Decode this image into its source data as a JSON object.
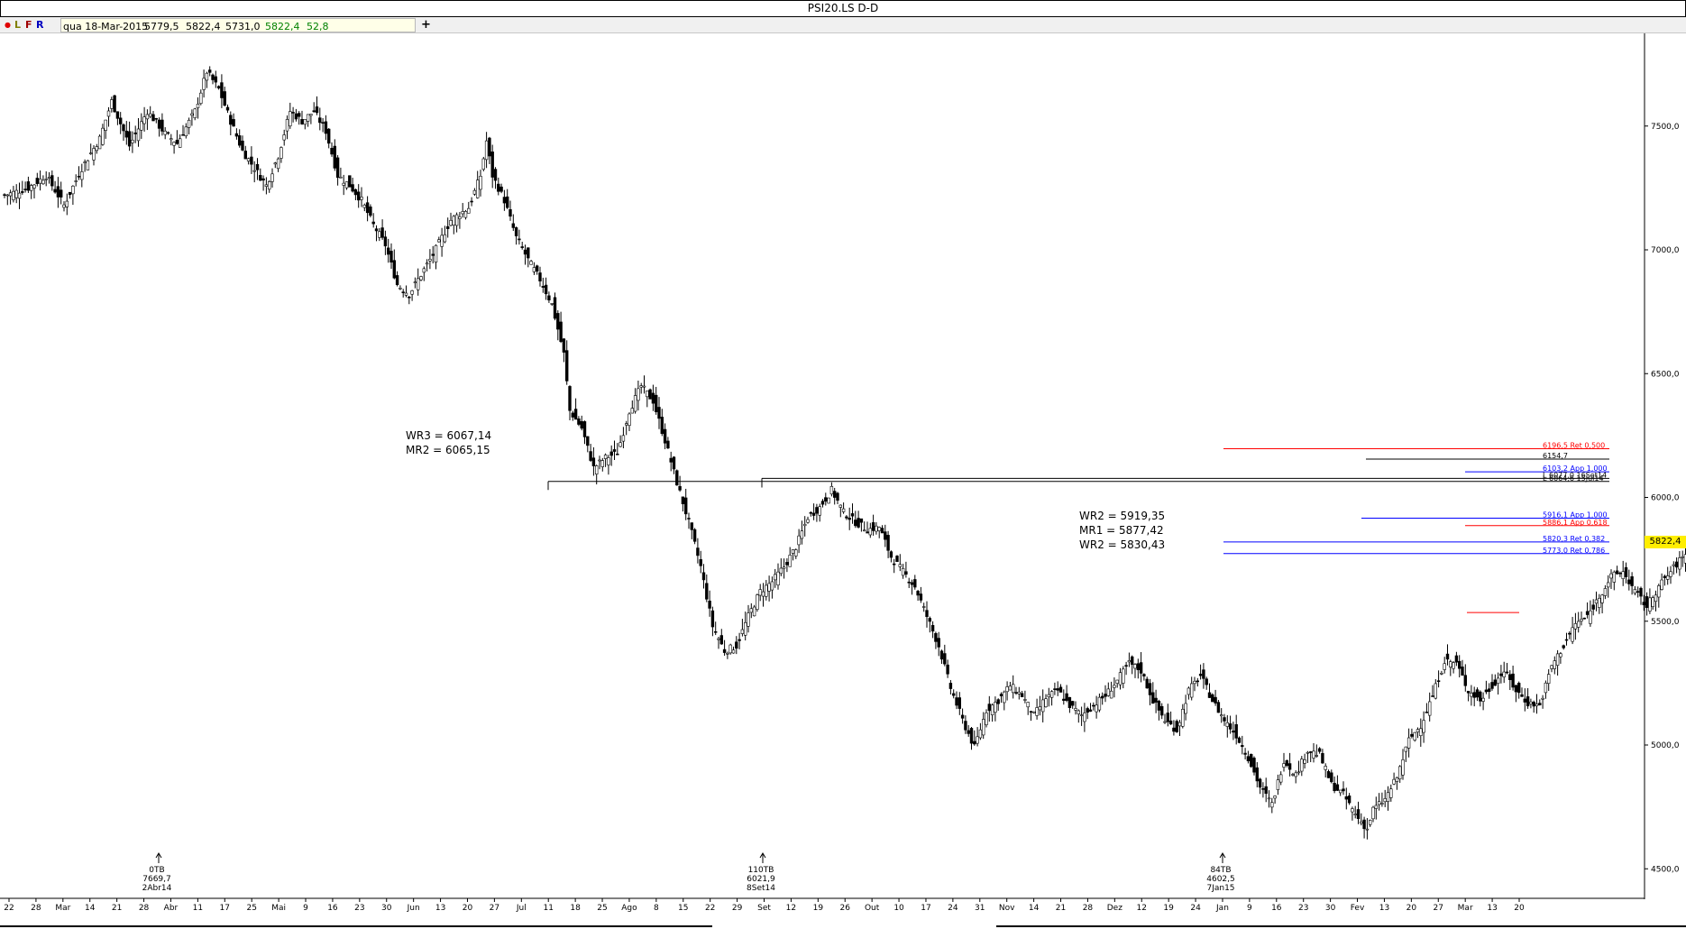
{
  "window": {
    "title": "PSI20.LS D-D",
    "add_label": "+"
  },
  "toolbar": {
    "dot": "●",
    "buttons": [
      "L",
      "F",
      "R"
    ],
    "colors": {
      "dot": "#e00000",
      "L": "#808000",
      "F": "#a00000",
      "R": "#0000c0"
    }
  },
  "ohlc": {
    "date": "qua 18-Mar-2015",
    "open": "5779,5",
    "high": "5822,4",
    "low": "5731,0",
    "close": "5822,4",
    "change": "52,8",
    "change_color": "#008000"
  },
  "current_price_label": "5822,4",
  "chart_data": {
    "type": "candlestick",
    "title": "PSI20.LS D-D",
    "ylim": [
      4450,
      7925
    ],
    "y_ticks": [
      {
        "value": 4500,
        "label": "4500,0"
      },
      {
        "value": 5000,
        "label": "5000,0"
      },
      {
        "value": 5500,
        "label": "5500,0"
      },
      {
        "value": 6000,
        "label": "6000,0"
      },
      {
        "value": 6500,
        "label": "6500,0"
      },
      {
        "value": 7000,
        "label": "7000,0"
      },
      {
        "value": 7500,
        "label": "7500,0"
      }
    ],
    "x_tick_labels": [
      "22",
      "28",
      "Mar",
      "14",
      "21",
      "28",
      "Abr",
      "11",
      "17",
      "25",
      "Mai",
      "9",
      "16",
      "23",
      "30",
      "Jun",
      "13",
      "20",
      "27",
      "Jul",
      "11",
      "18",
      "25",
      "Ago",
      "8",
      "15",
      "22",
      "29",
      "Set",
      "12",
      "19",
      "26",
      "Out",
      "10",
      "17",
      "24",
      "31",
      "Nov",
      "14",
      "21",
      "28",
      "Dez",
      "12",
      "19",
      "24",
      "Jan",
      "9",
      "16",
      "23",
      "30",
      "Fev",
      "13",
      "20",
      "27",
      "Mar",
      "13",
      "20"
    ],
    "close_path": [
      [
        0,
        7220
      ],
      [
        8,
        7250
      ],
      [
        14,
        7300
      ],
      [
        20,
        7180
      ],
      [
        26,
        7330
      ],
      [
        32,
        7450
      ],
      [
        36,
        7600
      ],
      [
        42,
        7420
      ],
      [
        48,
        7560
      ],
      [
        54,
        7470
      ],
      [
        58,
        7430
      ],
      [
        64,
        7560
      ],
      [
        68,
        7720
      ],
      [
        72,
        7650
      ],
      [
        76,
        7520
      ],
      [
        80,
        7400
      ],
      [
        84,
        7330
      ],
      [
        88,
        7260
      ],
      [
        92,
        7380
      ],
      [
        96,
        7560
      ],
      [
        100,
        7520
      ],
      [
        104,
        7560
      ],
      [
        108,
        7480
      ],
      [
        112,
        7300
      ],
      [
        116,
        7260
      ],
      [
        120,
        7200
      ],
      [
        124,
        7100
      ],
      [
        128,
        7020
      ],
      [
        132,
        6860
      ],
      [
        136,
        6820
      ],
      [
        140,
        6900
      ],
      [
        144,
        6980
      ],
      [
        150,
        7120
      ],
      [
        156,
        7170
      ],
      [
        160,
        7300
      ],
      [
        162,
        7440
      ],
      [
        164,
        7300
      ],
      [
        168,
        7200
      ],
      [
        172,
        7050
      ],
      [
        176,
        6960
      ],
      [
        180,
        6880
      ],
      [
        184,
        6780
      ],
      [
        188,
        6580
      ],
      [
        190,
        6350
      ],
      [
        194,
        6280
      ],
      [
        198,
        6120
      ],
      [
        202,
        6160
      ],
      [
        206,
        6180
      ],
      [
        210,
        6350
      ],
      [
        214,
        6450
      ],
      [
        218,
        6390
      ],
      [
        222,
        6230
      ],
      [
        226,
        6060
      ],
      [
        230,
        5900
      ],
      [
        234,
        5720
      ],
      [
        238,
        5480
      ],
      [
        242,
        5380
      ],
      [
        246,
        5400
      ],
      [
        250,
        5520
      ],
      [
        254,
        5620
      ],
      [
        258,
        5660
      ],
      [
        262,
        5720
      ],
      [
        266,
        5800
      ],
      [
        270,
        5920
      ],
      [
        274,
        5960
      ],
      [
        278,
        6030
      ],
      [
        282,
        5940
      ],
      [
        286,
        5900
      ],
      [
        290,
        5870
      ],
      [
        294,
        5880
      ],
      [
        298,
        5760
      ],
      [
        302,
        5700
      ],
      [
        306,
        5640
      ],
      [
        310,
        5520
      ],
      [
        314,
        5400
      ],
      [
        318,
        5230
      ],
      [
        322,
        5100
      ],
      [
        326,
        4990
      ],
      [
        330,
        5140
      ],
      [
        334,
        5180
      ],
      [
        338,
        5240
      ],
      [
        342,
        5200
      ],
      [
        346,
        5120
      ],
      [
        350,
        5190
      ],
      [
        354,
        5220
      ],
      [
        358,
        5160
      ],
      [
        362,
        5120
      ],
      [
        366,
        5160
      ],
      [
        370,
        5200
      ],
      [
        374,
        5260
      ],
      [
        378,
        5330
      ],
      [
        382,
        5300
      ],
      [
        386,
        5180
      ],
      [
        390,
        5100
      ],
      [
        394,
        5060
      ],
      [
        398,
        5220
      ],
      [
        402,
        5280
      ],
      [
        406,
        5180
      ],
      [
        410,
        5100
      ],
      [
        414,
        5040
      ],
      [
        418,
        4950
      ],
      [
        422,
        4830
      ],
      [
        426,
        4760
      ],
      [
        430,
        4940
      ],
      [
        434,
        4880
      ],
      [
        438,
        4980
      ],
      [
        442,
        4960
      ],
      [
        446,
        4840
      ],
      [
        450,
        4800
      ],
      [
        454,
        4720
      ],
      [
        458,
        4660
      ],
      [
        460,
        4740
      ],
      [
        464,
        4780
      ],
      [
        468,
        4870
      ],
      [
        472,
        5020
      ],
      [
        476,
        5080
      ],
      [
        480,
        5200
      ],
      [
        484,
        5340
      ],
      [
        488,
        5330
      ],
      [
        492,
        5220
      ],
      [
        496,
        5180
      ],
      [
        500,
        5240
      ],
      [
        504,
        5300
      ],
      [
        508,
        5220
      ],
      [
        512,
        5170
      ],
      [
        516,
        5160
      ],
      [
        520,
        5320
      ],
      [
        524,
        5400
      ],
      [
        528,
        5490
      ],
      [
        532,
        5520
      ],
      [
        536,
        5600
      ],
      [
        540,
        5680
      ],
      [
        544,
        5700
      ],
      [
        548,
        5620
      ],
      [
        552,
        5560
      ],
      [
        556,
        5640
      ],
      [
        560,
        5700
      ],
      [
        564,
        5760
      ],
      [
        568,
        5822
      ]
    ],
    "pivot_annotations": [
      {
        "lines": [
          "WR3 = 6067,14",
          "MR2 = 6065,15"
        ]
      },
      {
        "lines": [
          "WR2 = 5919,35",
          "MR1 = 5877,42",
          "WR2 = 5830,43"
        ]
      }
    ],
    "levels": [
      {
        "value": 6196.5,
        "label": "6196,5 Ret 0,500",
        "color": "#ff0000"
      },
      {
        "value": 6154.7,
        "label": "6154,7",
        "color": "#000000"
      },
      {
        "value": 6103.2,
        "label": "6103,2 App 1,000",
        "color": "#0000ff"
      },
      {
        "value": 6077.0,
        "label": "L 6077,0 16Set14",
        "color": "#000000"
      },
      {
        "value": 6064.6,
        "label": "L 6064,6 15Jul14",
        "color": "#000000"
      },
      {
        "value": 5916.1,
        "label": "5916,1 App 1,000",
        "color": "#0000ff"
      },
      {
        "value": 5886.1,
        "label": "5886,1 App 0,618",
        "color": "#ff0000"
      },
      {
        "value": 5820.3,
        "label": "5820,3 Ret 0,382",
        "color": "#0000ff"
      },
      {
        "value": 5773.0,
        "label": "5773,0 Ret 0,786",
        "color": "#0000ff"
      },
      {
        "value": 5535.0,
        "label": "",
        "color": "#ff0000"
      }
    ],
    "markers": [
      {
        "label": [
          "0TB",
          "7669,7",
          "2Abr14"
        ]
      },
      {
        "label": [
          "110TB",
          "6021,9",
          "8Set14"
        ]
      },
      {
        "label": [
          "84TB",
          "4602,5",
          "7Jan15"
        ]
      }
    ]
  }
}
